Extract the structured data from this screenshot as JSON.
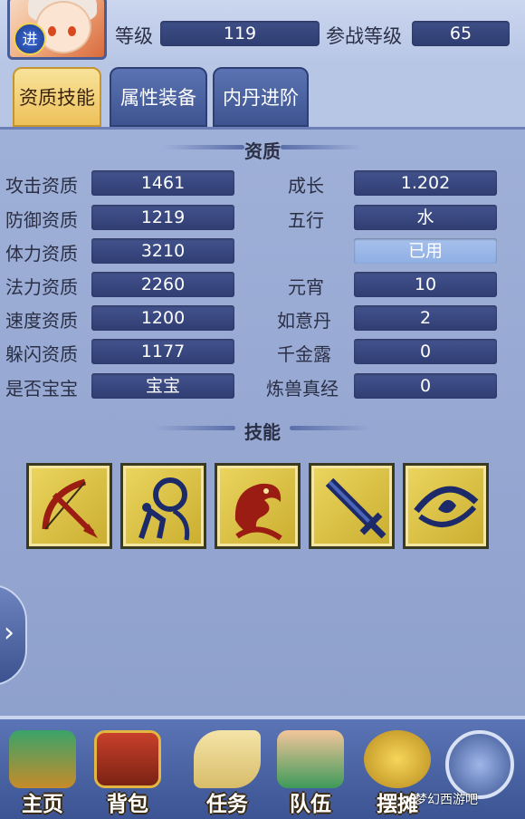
{
  "header": {
    "avatar_badge": "进",
    "level_label": "等级",
    "level_value": "119",
    "battle_level_label": "参战等级",
    "battle_level_value": "65"
  },
  "tabs": [
    {
      "label": "资质技能",
      "active": true
    },
    {
      "label": "属性装备",
      "active": false
    },
    {
      "label": "内丹进阶",
      "active": false
    }
  ],
  "aptitude": {
    "title": "资质",
    "left": [
      {
        "label": "攻击资质",
        "value": "1461"
      },
      {
        "label": "防御资质",
        "value": "1219"
      },
      {
        "label": "体力资质",
        "value": "3210"
      },
      {
        "label": "法力资质",
        "value": "2260"
      },
      {
        "label": "速度资质",
        "value": "1200"
      },
      {
        "label": "躲闪资质",
        "value": "1177"
      },
      {
        "label": "是否宝宝",
        "value": "宝宝"
      }
    ],
    "right": [
      {
        "label": "成长",
        "value": "1.202"
      },
      {
        "label": "五行",
        "value": "水"
      },
      {
        "label": "",
        "value": "已用"
      },
      {
        "label": "元宵",
        "value": "10"
      },
      {
        "label": "如意丹",
        "value": "2"
      },
      {
        "label": "千金露",
        "value": "0"
      },
      {
        "label": "炼兽真经",
        "value": "0"
      }
    ]
  },
  "skills": {
    "title": "技能",
    "icons": [
      "bow-skill-icon",
      "figure-skill-icon",
      "dragon-skill-icon",
      "sword-skill-icon",
      "eye-skill-icon"
    ]
  },
  "bottom_nav": [
    {
      "label": "主页",
      "icon": "pavilion-icon"
    },
    {
      "label": "背包",
      "icon": "treasure-chest-icon"
    },
    {
      "label": "任务",
      "icon": "scroll-icon"
    },
    {
      "label": "队伍",
      "icon": "team-icon"
    },
    {
      "label": "摆摊",
      "icon": "coin-icon"
    }
  ],
  "watermark": "梦幻西游吧",
  "colors": {
    "panel_bg": "#9fb0d8",
    "value_box": "#2f3d72",
    "active_tab": "#eec15a",
    "skill_frame": "#c9ad2e"
  }
}
